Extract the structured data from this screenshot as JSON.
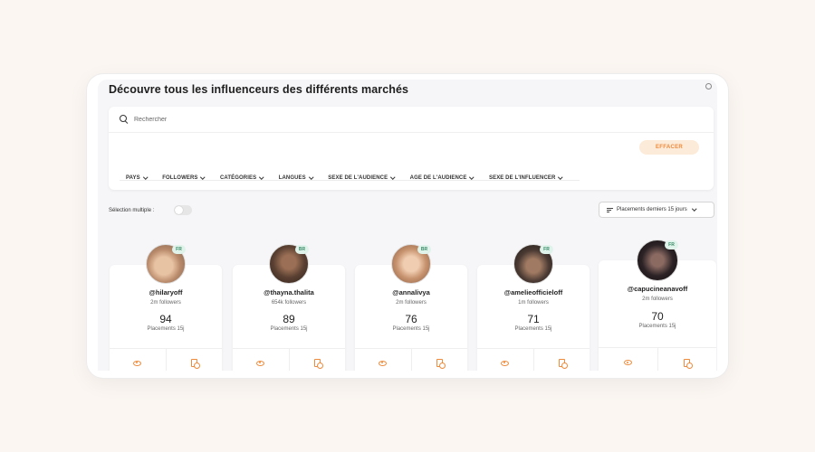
{
  "page": {
    "title": "Découvre tous les influenceurs des différents marchés"
  },
  "search": {
    "placeholder": "Rechercher"
  },
  "actions": {
    "clear_label": "EFFACER"
  },
  "filters": [
    {
      "label": "PAYS"
    },
    {
      "label": "FOLLOWERS"
    },
    {
      "label": "CATÉGORIES"
    },
    {
      "label": "LANGUES"
    },
    {
      "label": "SEXE DE L'AUDIENCE"
    },
    {
      "label": "AGE DE L'AUDIENCE"
    },
    {
      "label": "SEXE DE L'INFLUENCER"
    }
  ],
  "selection": {
    "label": "Sélection multiple :",
    "enabled": false
  },
  "sort": {
    "label": "Placements derniers 15 jours"
  },
  "colors": {
    "accent": "#ee8a3a",
    "accent_bg": "#fdebd9",
    "badge_bg": "#dff3ea",
    "badge_text": "#3a8a68"
  },
  "influencers": [
    {
      "handle": "@hilaryoff",
      "country": "FR",
      "followers": "2m followers",
      "placements": "94",
      "placements_label": "Placements 15j",
      "avatar_color": "#b98b6c"
    },
    {
      "handle": "@thayna.thalita",
      "country": "BR",
      "followers": "654k followers",
      "placements": "89",
      "placements_label": "Placements 15j",
      "avatar_color": "#5a4032"
    },
    {
      "handle": "@annalivya",
      "country": "BR",
      "followers": "2m followers",
      "placements": "76",
      "placements_label": "Placements 15j",
      "avatar_color": "#c7936f"
    },
    {
      "handle": "@amelieofficieloff",
      "country": "FR",
      "followers": "1m followers",
      "placements": "71",
      "placements_label": "Placements 15j",
      "avatar_color": "#4a3a33"
    },
    {
      "handle": "@capucineanavoff",
      "country": "FR",
      "followers": "2m followers",
      "placements": "70",
      "placements_label": "Placements 15j",
      "avatar_color": "#2c2326"
    }
  ]
}
